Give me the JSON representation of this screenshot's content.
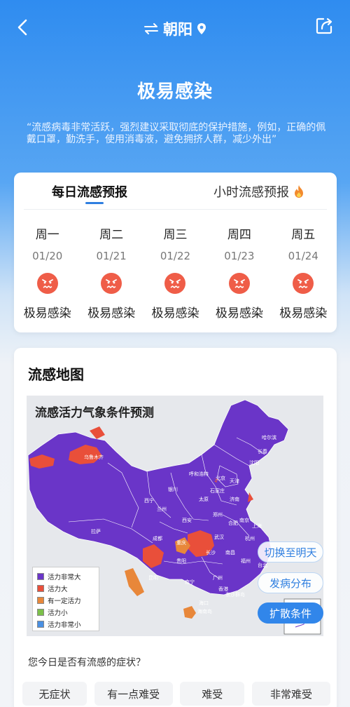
{
  "header": {
    "location": "朝阳",
    "back_icon": "chevron-left-icon",
    "swap_icon": "swap-arrows-icon",
    "pin_icon": "location-pin-icon",
    "share_icon": "share-icon"
  },
  "hero": {
    "level": "极易感染",
    "advice": "“流感病毒非常活跃，强烈建议采取彻底的保护措施，例如，正确的佩戴口罩，勤洗手，使用消毒液，避免拥挤人群，减少外出”"
  },
  "forecast": {
    "tabs": [
      "每日流感预报",
      "小时流感预报"
    ],
    "active_tab": 0,
    "days": [
      {
        "weekday": "周一",
        "date": "01/20",
        "level": "极易感染"
      },
      {
        "weekday": "周二",
        "date": "01/21",
        "level": "极易感染"
      },
      {
        "weekday": "周三",
        "date": "01/22",
        "level": "极易感染"
      },
      {
        "weekday": "周四",
        "date": "01/23",
        "level": "极易感染"
      },
      {
        "weekday": "周五",
        "date": "01/24",
        "level": "极易感染"
      }
    ]
  },
  "map": {
    "section_title": "流感地图",
    "heading": "流感活力气象条件预测",
    "legend": [
      {
        "label": "活力非常大",
        "color": "#6a35c8"
      },
      {
        "label": "活力大",
        "color": "#e94f3a"
      },
      {
        "label": "有一定活力",
        "color": "#e8873a"
      },
      {
        "label": "活力小",
        "color": "#7cc04a"
      },
      {
        "label": "活力非常小",
        "color": "#4a90e2"
      }
    ],
    "cities": [
      "乌鲁木齐",
      "拉萨",
      "西宁",
      "兰州",
      "银川",
      "呼和浩特",
      "北京",
      "天津",
      "石家庄",
      "太原",
      "济南",
      "郑州",
      "西安",
      "成都",
      "重庆",
      "武汉",
      "合肥",
      "南京",
      "上海",
      "杭州",
      "长沙",
      "南昌",
      "福州",
      "贵阳",
      "昆明",
      "南宁",
      "广州",
      "香港",
      "海口",
      "台北",
      "沈阳",
      "长春",
      "哈尔滨",
      "东沙群岛",
      "海南岛"
    ],
    "buttons": {
      "next_day": "切换至明天",
      "distribution": "发病分布",
      "spread": "扩散条件"
    }
  },
  "survey": {
    "question": "您今日是否有流感的症状？",
    "options": [
      "无症状",
      "有一点难受",
      "难受",
      "非常难受"
    ]
  }
}
